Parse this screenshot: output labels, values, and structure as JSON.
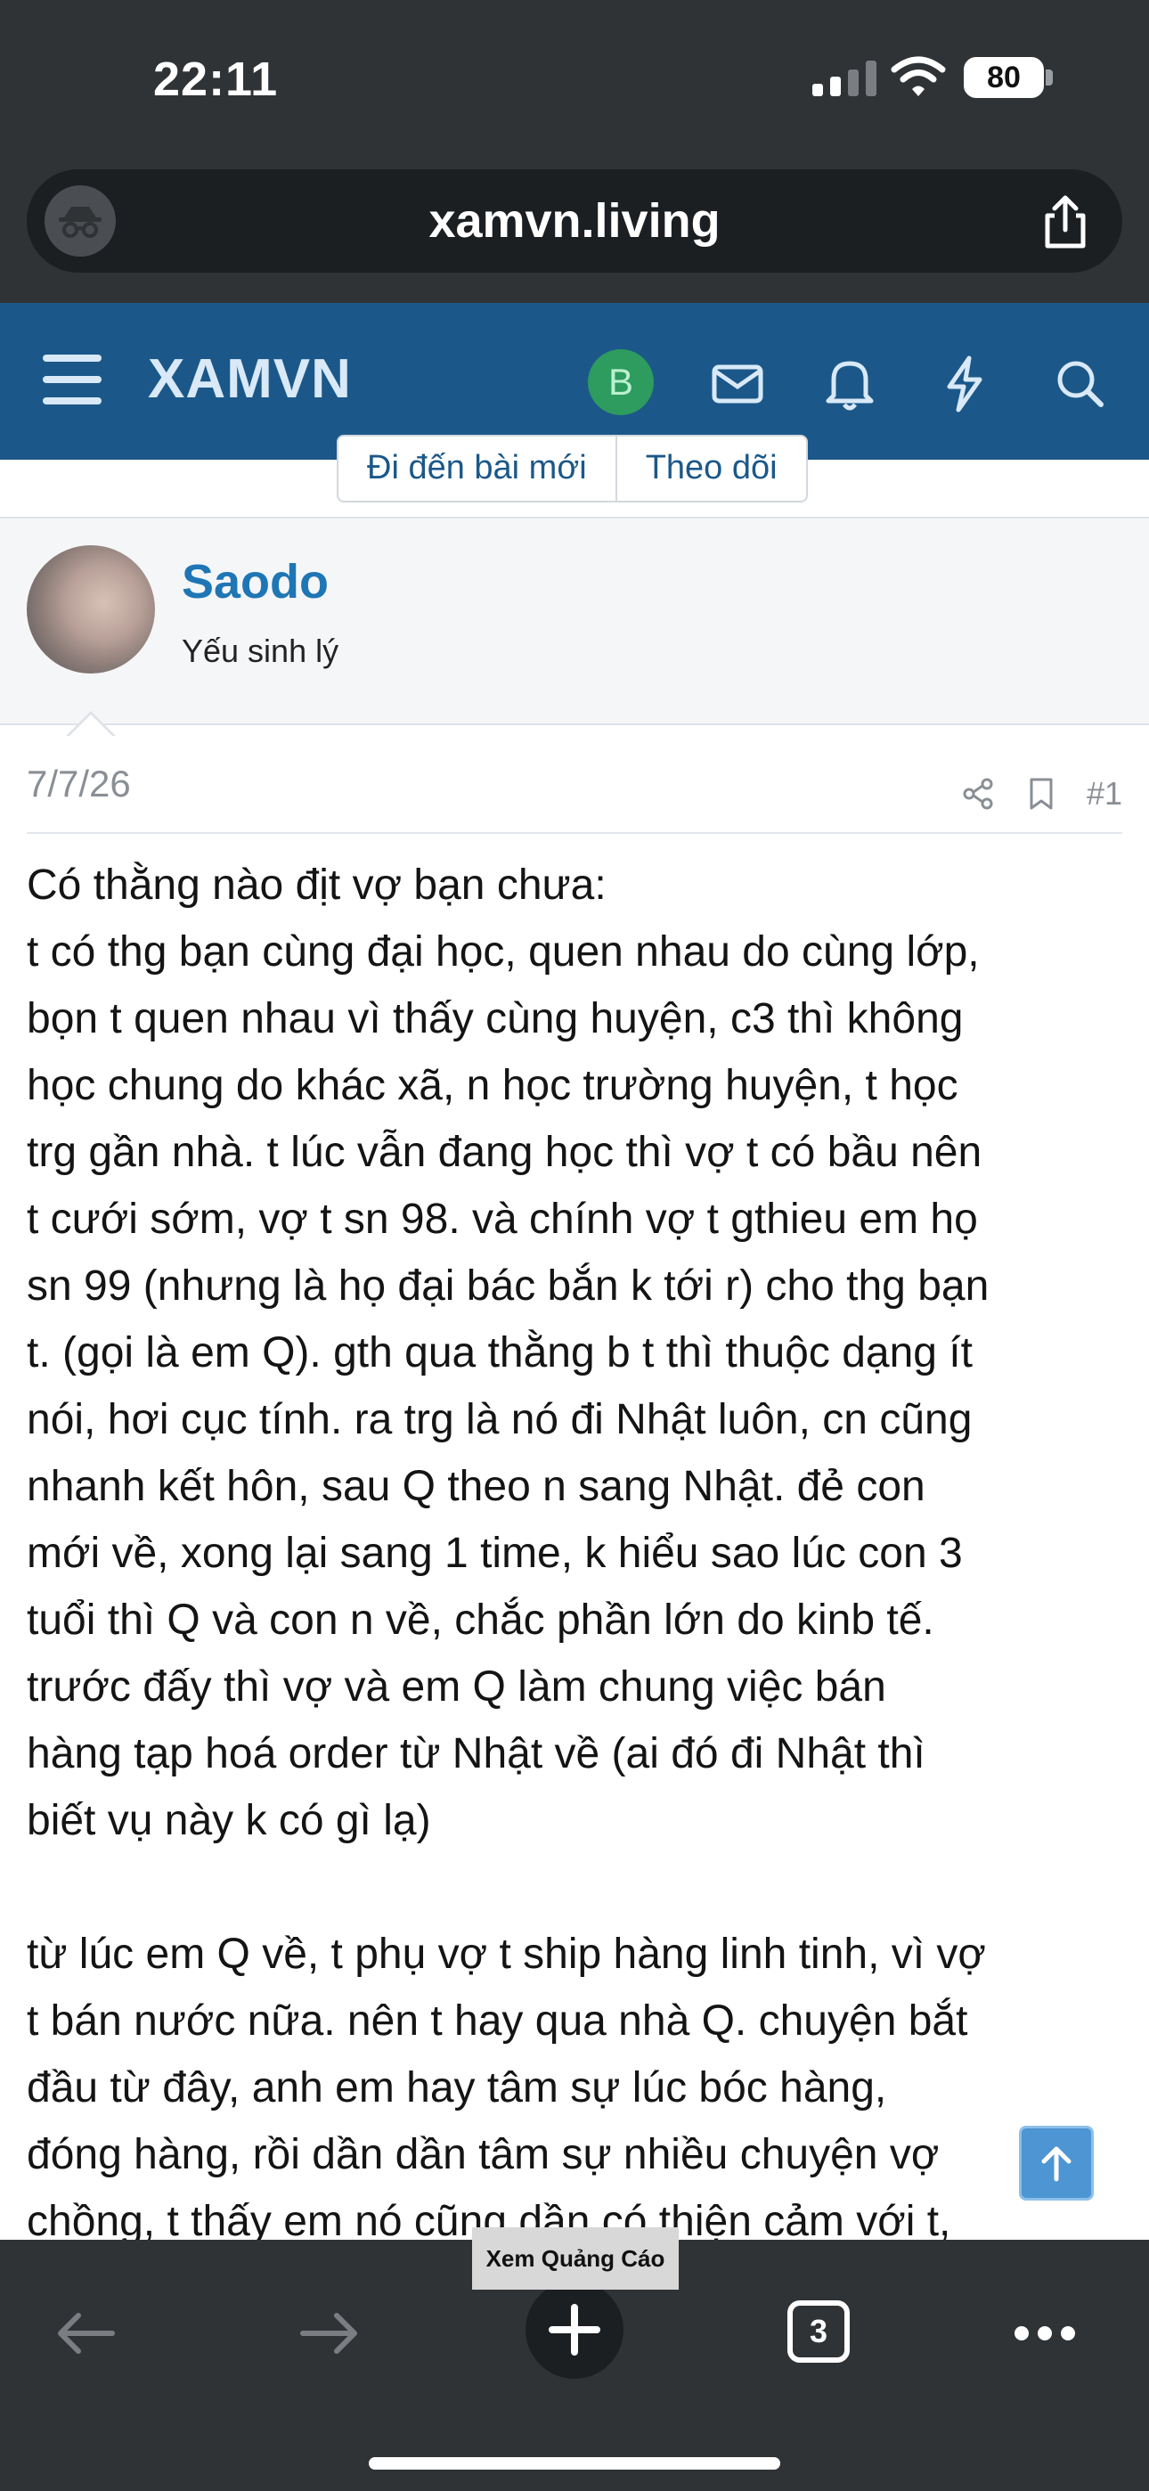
{
  "status_bar": {
    "time": "22:11",
    "battery": "80"
  },
  "browser": {
    "url": "xamvn.living"
  },
  "site": {
    "logo": "XAMVN",
    "avatar_letter": "B"
  },
  "pager": {
    "new_posts": "Đi đến bài mới",
    "follow": "Theo dõi"
  },
  "post": {
    "author": "Saodo",
    "author_title": "Yếu sinh lý",
    "date": "7/7/26",
    "number": "#1",
    "body": "Có thằng nào địt vợ bạn chưa:\nt có thg bạn cùng đại học, quen nhau do cùng lớp,\nbọn t quen nhau vì thấy cùng huyện, c3 thì không\nhọc chung do khác xã, n học trường huyện, t học\ntrg gần nhà. t lúc vẫn đang học thì vợ t có bầu nên\nt cưới sớm, vợ t sn 98. và chính vợ t gthieu em họ\nsn 99 (nhưng là họ đại bác bắn k tới r) cho thg bạn\nt. (gọi là em Q). gth qua thằng b t thì thuộc dạng ít\nnói, hơi cục tính. ra trg là nó đi Nhật luôn, cn cũng\nnhanh kết hôn, sau Q theo n sang Nhật. đẻ con\nmới về, xong lại sang 1 time, k hiểu sao lúc con 3\ntuổi thì Q và con n về, chắc phần lớn do kinb tế.\ntrước đấy thì vợ và em Q làm chung việc bán\nhàng tạp hoá order từ Nhật về (ai đó đi Nhật thì\nbiết vụ này k có gì lạ)\n\ntừ lúc em Q về, t phụ vợ t ship hàng linh tinh, vì vợ\nt bán nước nữa. nên t hay qua nhà Q. chuyện bắt\nđầu từ đây, anh em hay tâm sự lúc bóc hàng,\nđóng hàng, rồi dần dần tâm sự nhiều chuyện vợ\nchồng, t thấy em nó cũng dần có thiện cảm với t,\nem Q kể lúc ở Nhật k          t tát vài lần, vụ n về"
  },
  "ad": {
    "label": "Xem Quảng Cáo"
  },
  "toolbar": {
    "tabs_count": "3"
  }
}
